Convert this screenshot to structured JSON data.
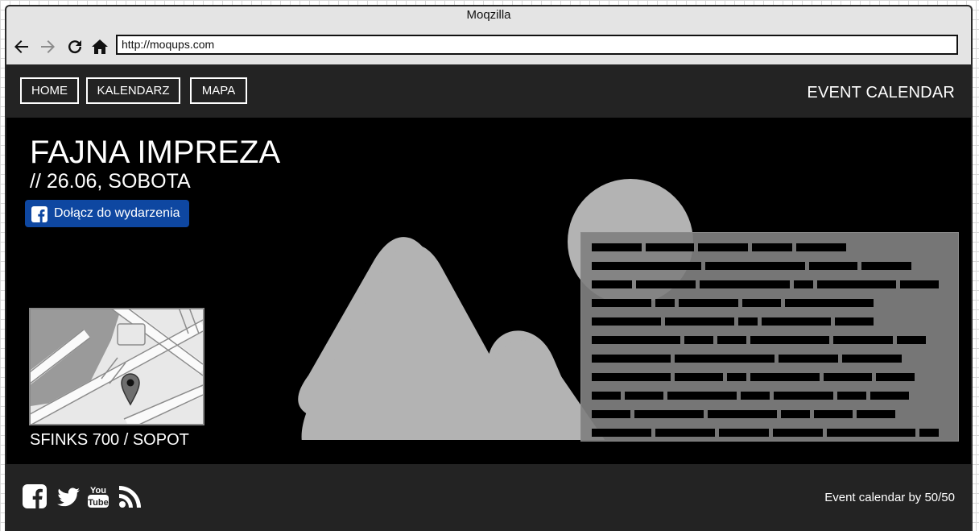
{
  "window": {
    "title": "Moqzilla"
  },
  "browser": {
    "url": "http://moqups.com"
  },
  "nav": {
    "items": [
      {
        "label": "HOME"
      },
      {
        "label": "KALENDARZ"
      },
      {
        "label": "MAPA"
      }
    ],
    "site_title": "EVENT CALENDAR"
  },
  "event": {
    "title": "FAJNA IMPREZA",
    "date": "// 26.06, SOBOTA",
    "join_label": "Dołącz do wydarzenia",
    "location": "SFINKS 700 / SOPOT"
  },
  "footer": {
    "credit": "Event calendar by 50/50",
    "icons": [
      "facebook-icon",
      "twitter-icon",
      "youtube-icon",
      "rss-icon"
    ]
  },
  "colors": {
    "header_bg": "#232323",
    "content_bg": "#000000",
    "fb_button": "#0e47a1",
    "placeholder": "#b3b3b3"
  }
}
